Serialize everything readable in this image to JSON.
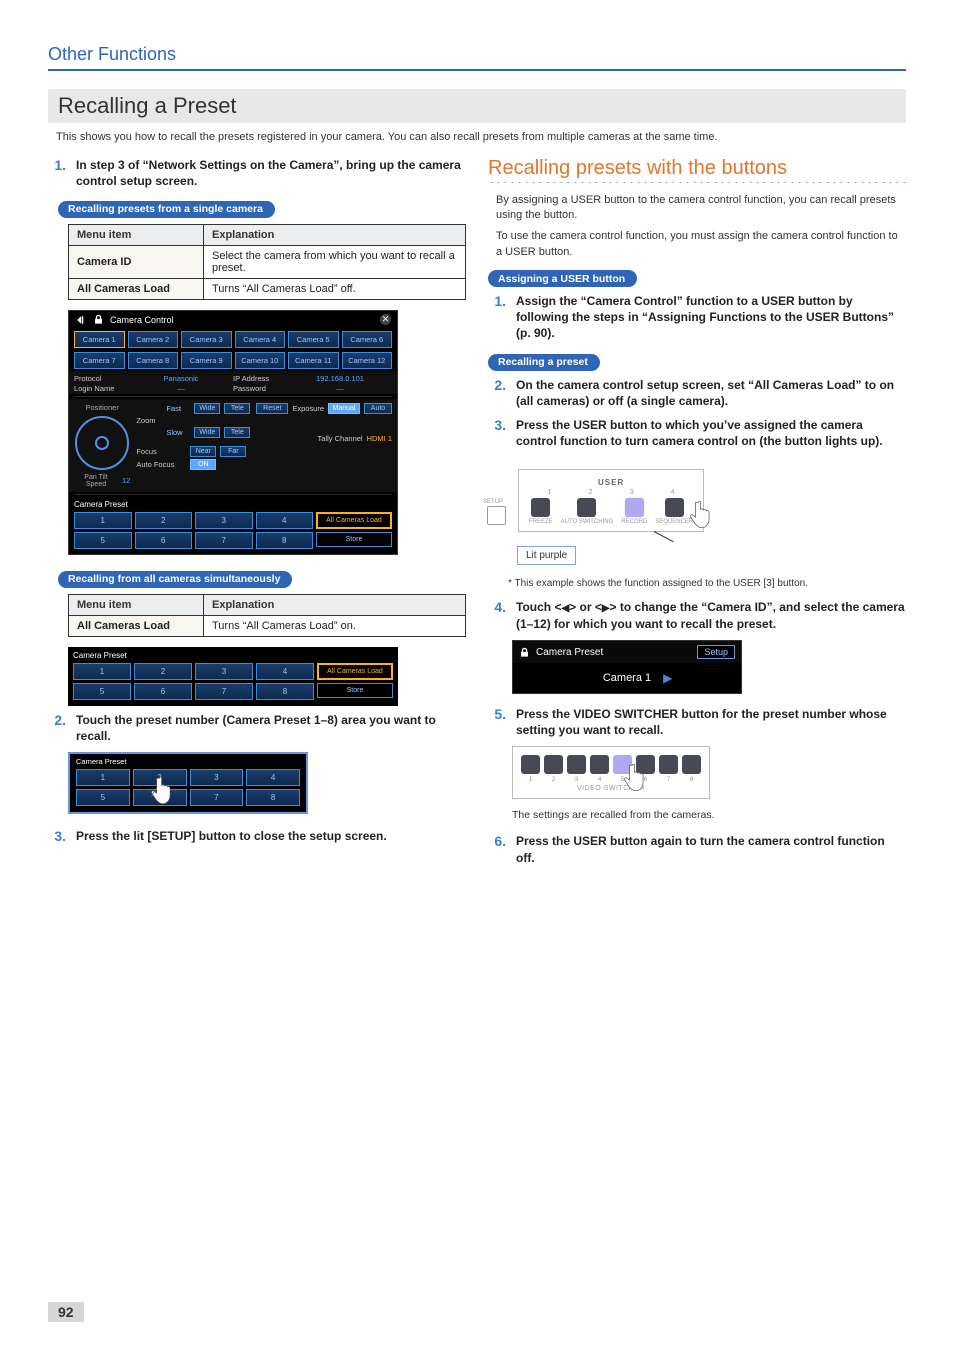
{
  "header": {
    "section": "Other Functions"
  },
  "title": "Recalling a Preset",
  "intro": "This shows you how to recall the presets registered in your camera. You can also recall presets from multiple cameras at the same time.",
  "left": {
    "step1": "In step 3 of “Network Settings on the Camera”, bring up the camera control setup screen.",
    "pill_single": "Recalling presets from a single camera",
    "table1": {
      "headers": [
        "Menu item",
        "Explanation"
      ],
      "rows": [
        {
          "label": "Camera ID",
          "value": "Select the camera from which you want to recall a preset."
        },
        {
          "label": "All Cameras Load",
          "value": "Turns “All Cameras Load” off."
        }
      ]
    },
    "cc_panel": {
      "title": "Camera Control",
      "cams_a": [
        "Camera 1",
        "Camera 2",
        "Camera 3",
        "Camera 4",
        "Camera 5",
        "Camera 6"
      ],
      "cams_b": [
        "Camera 7",
        "Camera 8",
        "Camera 9",
        "Camera 10",
        "Camera 11",
        "Camera 12"
      ],
      "info": {
        "protocol_label": "Protocol",
        "protocol_value": "Panasonic",
        "ip_label": "IP Address",
        "ip_value": "192.168.0.101",
        "login_label": "Login Name",
        "login_value": "—",
        "pass_label": "Password",
        "pass_value": "—"
      },
      "positioner": "Positioner",
      "zoom": "Zoom",
      "focus": "Focus",
      "auto_focus": "Auto Focus",
      "fast": "Fast",
      "slow": "Slow",
      "wide": "Wide",
      "tele": "Tele",
      "near": "Near",
      "far": "Far",
      "reset": "Reset",
      "exposure": "Exposure",
      "manual": "Manual",
      "auto": "Auto",
      "tally": "Tally Channel",
      "tally_val": "HDMI 1",
      "pantilt": "Pan Tilt Speed",
      "pantilt_val": "12",
      "on": "ON",
      "preset_label": "Camera Preset",
      "presets": [
        "1",
        "2",
        "3",
        "4",
        "5",
        "6",
        "7",
        "8"
      ],
      "all_load": "All Cameras Load",
      "store": "Store"
    },
    "pill_all": "Recalling from all cameras simultaneously",
    "table2": {
      "headers": [
        "Menu item",
        "Explanation"
      ],
      "rows": [
        {
          "label": "All Cameras Load",
          "value": "Turns “All Cameras Load” on."
        }
      ]
    },
    "strip": {
      "label": "Camera Preset",
      "cells": [
        "1",
        "2",
        "3",
        "4",
        "5",
        "6",
        "7",
        "8"
      ],
      "all_load": "All Cameras Load",
      "store": "Store"
    },
    "step2": "Touch the preset number (Camera Preset 1–8) area you want to recall.",
    "diag2": {
      "label": "Camera Preset",
      "cells": [
        "1",
        "2",
        "3",
        "4",
        "5",
        "6",
        "7",
        "8"
      ]
    },
    "step3": "Press the lit [SETUP] button to close the setup screen."
  },
  "right": {
    "subtitle": "Recalling presets with the buttons",
    "para1": "By assigning a USER button to the camera control function, you can recall presets using the button.",
    "para2": "To use the camera control function, you must assign the camera control function to a USER button.",
    "pill_assign": "Assigning a USER button",
    "step1": "Assign the “Camera Control” function to a USER button by following the steps in “Assigning Functions to the USER Buttons” (p. 90).",
    "pill_recall": "Recalling a preset",
    "step2": "On the camera control setup screen, set “All Cameras Load” to on (all cameras) or off (a single camera).",
    "step3": "Press the USER button to which you’ve assigned the camera control function to turn camera control on (the button lights up).",
    "user_panel": {
      "label": "USER",
      "nums": [
        "1",
        "2",
        "3",
        "4"
      ],
      "small_labels": [
        "FREEZE",
        "AUTO\nSWITCHING",
        "RECORD",
        "SEQUENCER"
      ],
      "setup": "SETUP",
      "callout": "Lit purple"
    },
    "note3_foot": "*  This example shows the function assigned to the USER [3] button.",
    "step4_prefix": "Touch <",
    "step4_mid1": "> or <",
    "step4_mid2": "> to change the “Camera ID”, and select the camera (1–12) for which you want to recall the preset.",
    "lcd": {
      "title": "Camera Preset",
      "setup": "Setup",
      "value": "Camera 1"
    },
    "step5": "Press the VIDEO SWITCHER button for the preset number whose setting you want to recall.",
    "vsw": {
      "label": "VIDEO SWITCHER",
      "nums": [
        "1",
        "2",
        "3",
        "4",
        "5",
        "6",
        "7",
        "8"
      ],
      "caption": "The settings are recalled from the cameras."
    },
    "step6": "Press the USER button again to turn the camera control function off."
  },
  "page_num": "92"
}
